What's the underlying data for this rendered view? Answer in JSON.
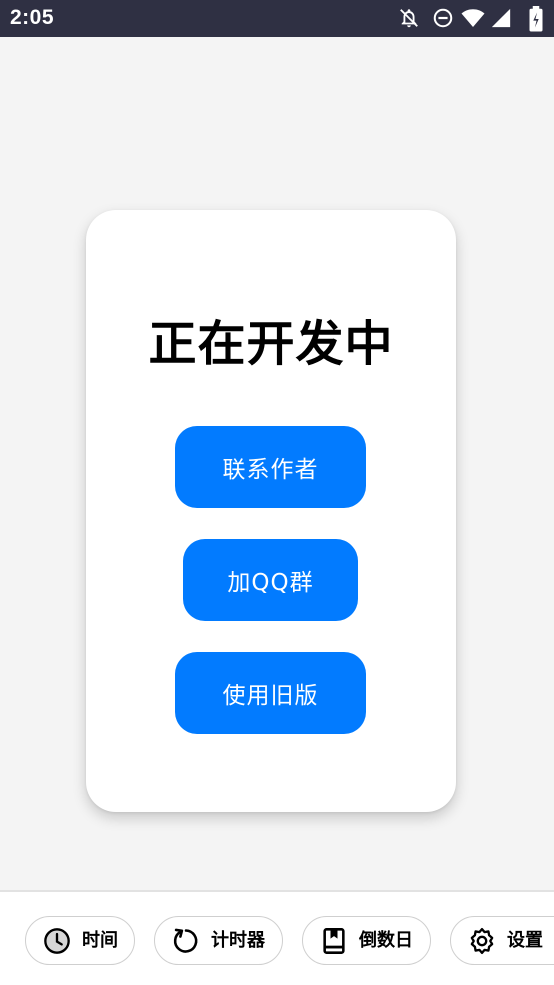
{
  "status_bar": {
    "time": "2:05",
    "icons": [
      "notifications-off-icon",
      "do-not-disturb-icon",
      "wifi-icon",
      "signal-icon",
      "battery-icon"
    ]
  },
  "card": {
    "title": "正在开发中",
    "buttons": {
      "contact_author": "联系作者",
      "join_qq_group": "加QQ群",
      "use_old_version": "使用旧版"
    }
  },
  "bottom_nav": {
    "items": [
      {
        "label": "时间",
        "icon": "clock-icon"
      },
      {
        "label": "计时器",
        "icon": "refresh-timer-icon"
      },
      {
        "label": "倒数日",
        "icon": "bookmark-book-icon"
      },
      {
        "label": "设置",
        "icon": "gear-icon"
      }
    ]
  },
  "colors": {
    "status_bar_bg": "#2f3043",
    "page_bg": "#f4f4f4",
    "accent_button": "#027bff",
    "card_bg": "#ffffff"
  }
}
